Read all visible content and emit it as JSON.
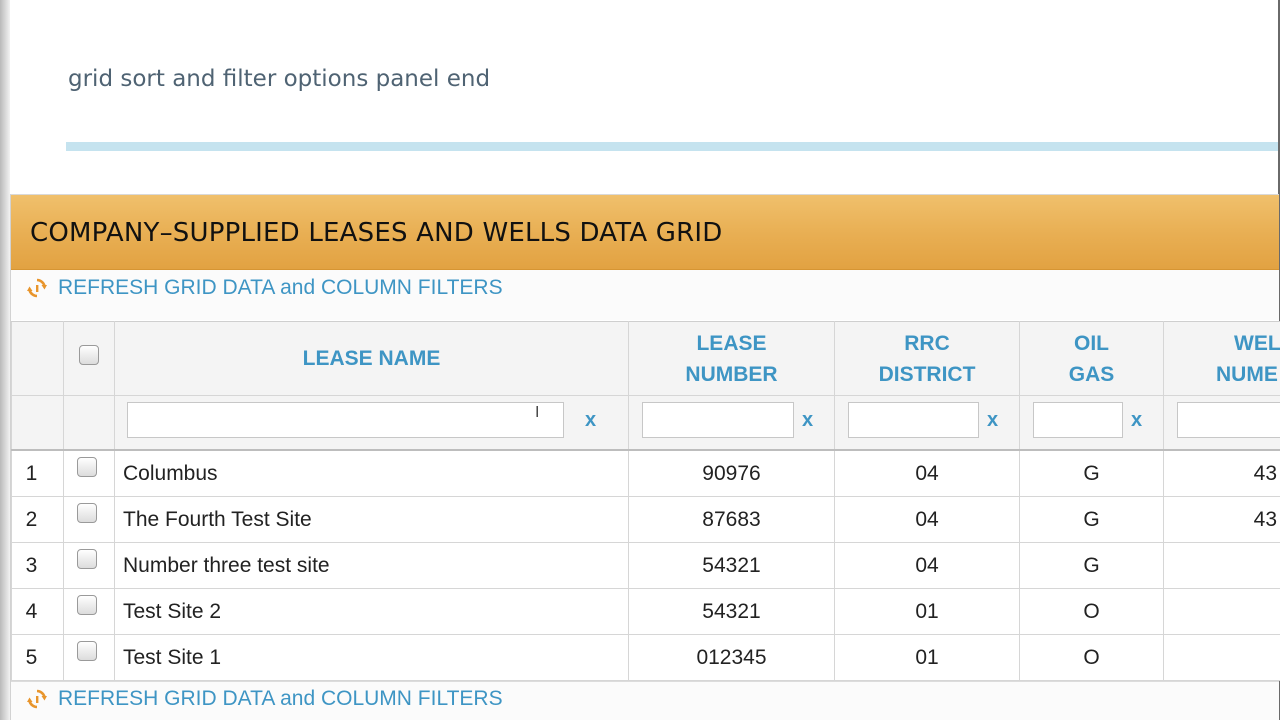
{
  "panel_end_text": "grid sort and filter options panel end",
  "grid": {
    "title": "COMPANY–SUPPLIED LEASES AND WELLS DATA GRID",
    "refresh_label_top": "REFRESH GRID DATA and COLUMN FILTERS",
    "refresh_label_bottom": "REFRESH GRID DATA and COLUMN FILTERS",
    "columns": [
      {
        "line1": "LEASE NAME",
        "line2": ""
      },
      {
        "line1": "LEASE",
        "line2": "NUMBER"
      },
      {
        "line1": "RRC",
        "line2": "DISTRICT"
      },
      {
        "line1": "OIL",
        "line2": "GAS"
      },
      {
        "line1": "WEL",
        "line2": "NUME"
      }
    ],
    "filter_clear": "x",
    "cursor_glyph": "I",
    "rows": [
      {
        "num": "1",
        "lease_name": "Columbus",
        "lease_number": "90976",
        "district": "04",
        "oil_gas": "G",
        "well": "43"
      },
      {
        "num": "2",
        "lease_name": "The Fourth Test Site",
        "lease_number": "87683",
        "district": "04",
        "oil_gas": "G",
        "well": "43"
      },
      {
        "num": "3",
        "lease_name": "Number three test site",
        "lease_number": "54321",
        "district": "04",
        "oil_gas": "G",
        "well": ""
      },
      {
        "num": "4",
        "lease_name": "Test Site 2",
        "lease_number": "54321",
        "district": "01",
        "oil_gas": "O",
        "well": ""
      },
      {
        "num": "5",
        "lease_name": "Test Site 1",
        "lease_number": "012345",
        "district": "01",
        "oil_gas": "O",
        "well": ""
      }
    ]
  },
  "colors": {
    "accent_blue": "#3e95c4",
    "header_orange": "#e8ae52",
    "divider_blue": "#c5e3ef"
  },
  "icons": {
    "refresh": "refresh-icon"
  }
}
